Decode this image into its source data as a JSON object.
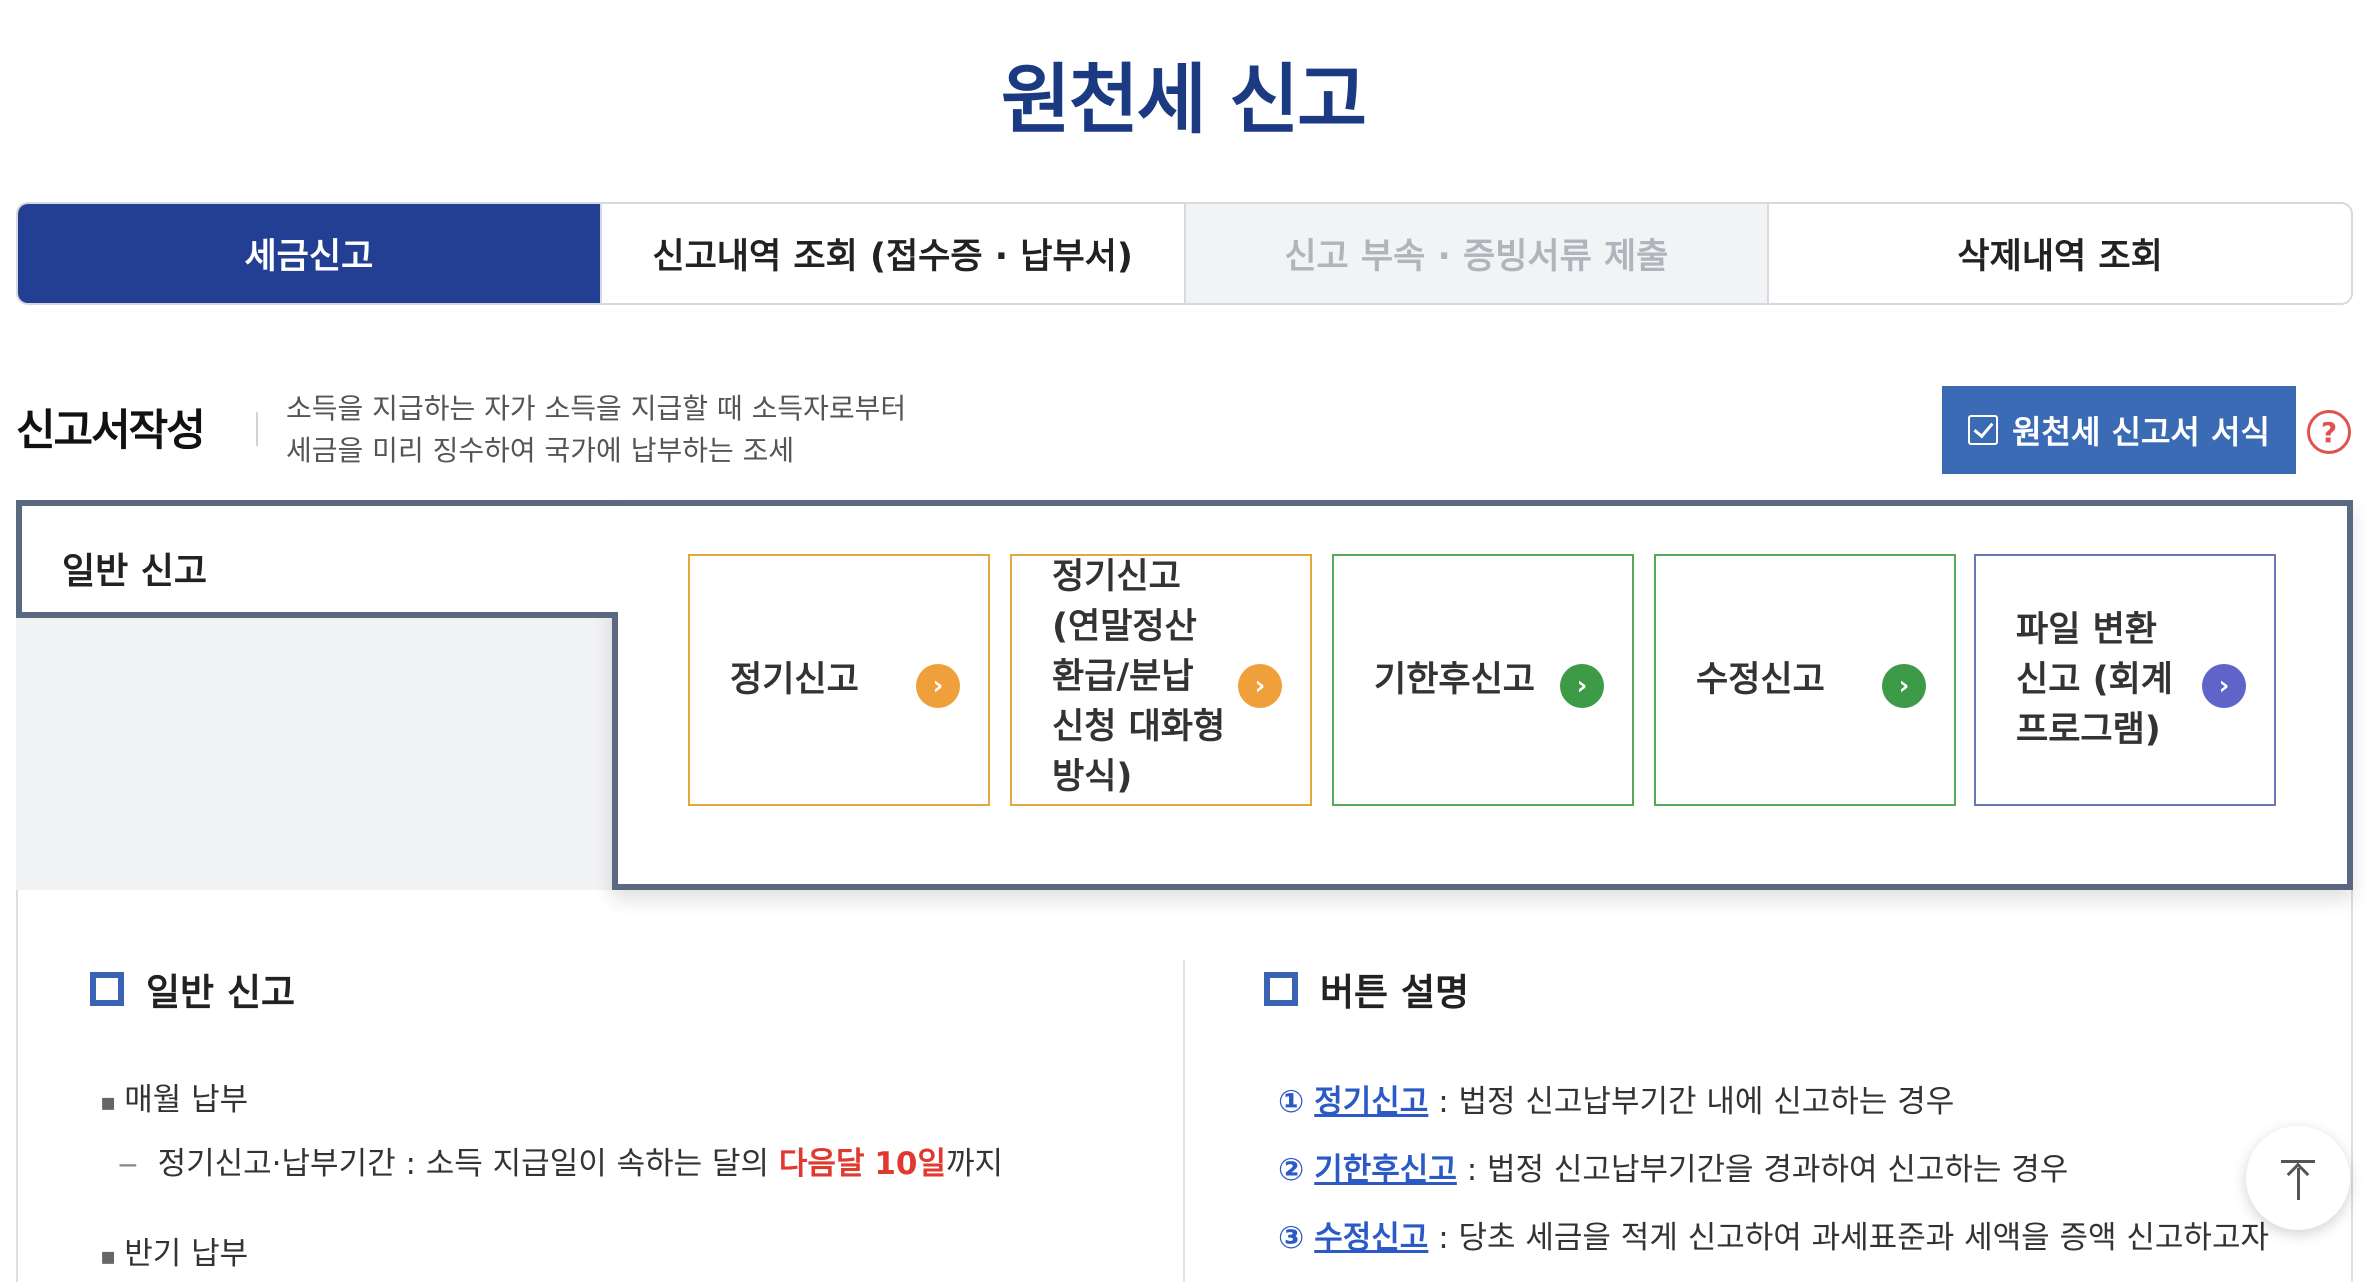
{
  "page": {
    "title": "원천세 신고"
  },
  "tabs": [
    {
      "label": "세금신고",
      "state": "active"
    },
    {
      "label": "신고내역 조회 (접수증 · 납부서)",
      "state": "normal"
    },
    {
      "label": "신고 부속 · 증빙서류 제출",
      "state": "disabled"
    },
    {
      "label": "삭제내역 조회",
      "state": "normal"
    }
  ],
  "section": {
    "title": "신고서작성",
    "desc_line1": "소득을 지급하는 자가 소득을 지급할 때 소득자로부터",
    "desc_line2": "세금을 미리 징수하여 국가에 납부하는 조세",
    "form_button": "원천세 신고서 서식",
    "help": "?"
  },
  "side_tab": {
    "label": "일반 신고"
  },
  "options": [
    {
      "label": "정기신고",
      "color": "#efa03a",
      "icon": "chevron-right-icon"
    },
    {
      "label": "정기신고 (연말정산 환급/분납 신청 대화형 방식)",
      "color": "#efa03a",
      "icon": "chevron-right-icon"
    },
    {
      "label": "기한후신고",
      "color": "#3d9a47",
      "icon": "chevron-right-icon"
    },
    {
      "label": "수정신고",
      "color": "#3d9a47",
      "icon": "chevron-right-icon"
    },
    {
      "label": "파일 변환 신고 (회계프로그램)",
      "color": "#5e64c8",
      "icon": "chevron-right-icon"
    }
  ],
  "left_col": {
    "heading": "일반 신고",
    "item1": "매월 납부",
    "item1_sub_prefix": "정기신고·납부기간 : 소득 지급일이 속하는 달의 ",
    "item1_sub_highlight1": "다음달",
    "item1_sub_highlight2": "10일",
    "item1_sub_suffix": "까지",
    "item2": "반기 납부"
  },
  "right_col": {
    "heading": "버튼 설명",
    "rows": [
      {
        "num": "①",
        "term": "정기신고",
        "text": " : 법정 신고납부기간 내에 신고하는 경우"
      },
      {
        "num": "②",
        "term": "기한후신고",
        "text": " : 법정 신고납부기간을 경과하여 신고하는 경우"
      },
      {
        "num": "③",
        "term": "수정신고",
        "text": " : 당초 세금을 적게 신고하여 과세표준과 세액을 증액 신고하고자 하는 경"
      }
    ]
  },
  "colors": {
    "brand": "#233f93",
    "title": "#1b3a82",
    "accent_red": "#e0392f",
    "button": "#3c6bb5"
  }
}
